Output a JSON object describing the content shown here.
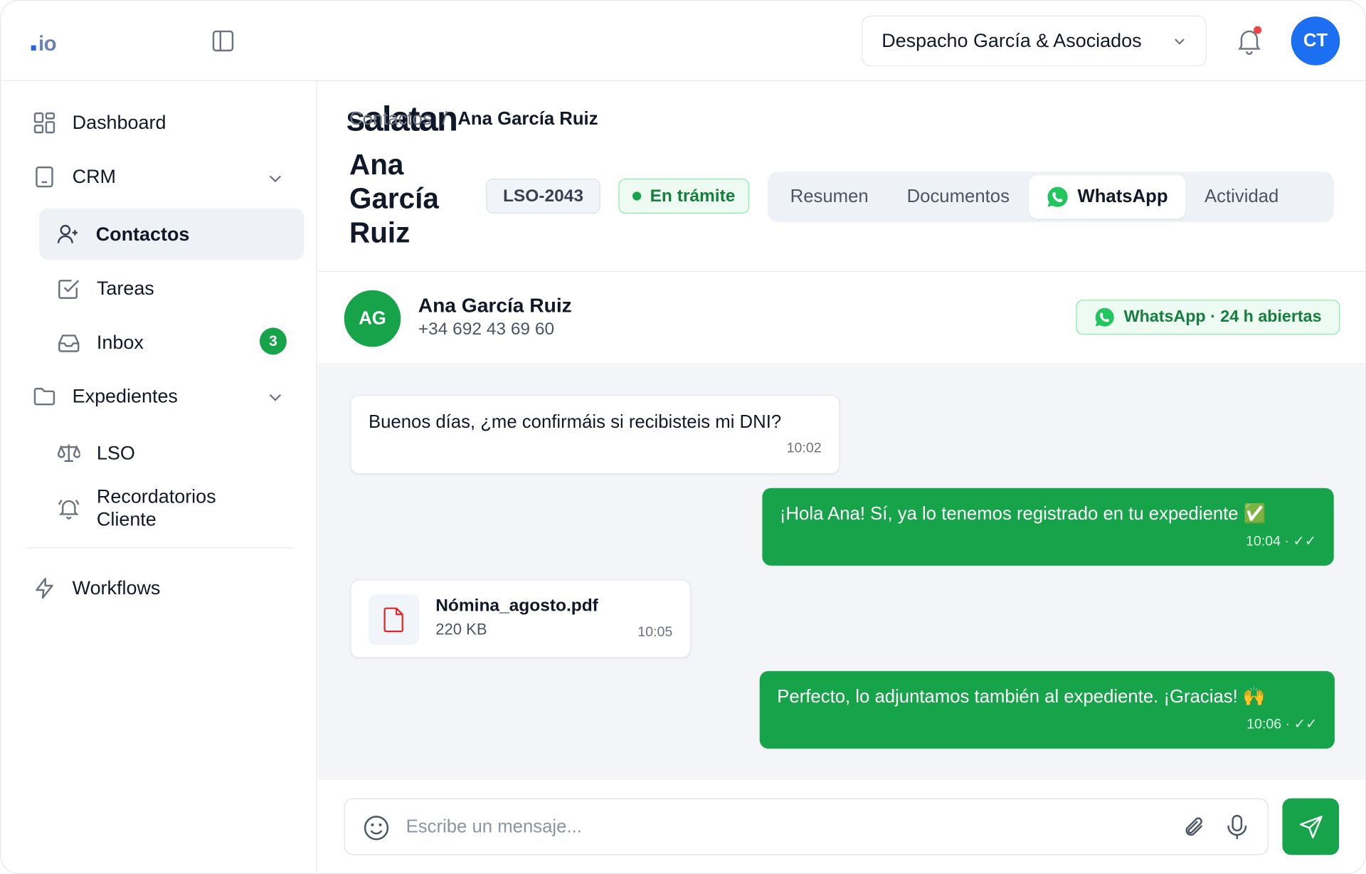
{
  "header": {
    "logo": {
      "main": "salatan",
      "dot": ".",
      "tld": "io"
    },
    "org_name": "Despacho García & Asociados",
    "user_initials": "CT",
    "notification_dot_color": "#ef4444"
  },
  "sidebar": {
    "items": [
      {
        "label": "Dashboard",
        "icon": "dashboard-grid-icon"
      },
      {
        "label": "CRM",
        "icon": "tablet-icon",
        "expanded": true
      },
      {
        "label": "Contactos",
        "icon": "user-plus-icon",
        "active": true
      },
      {
        "label": "Tareas",
        "icon": "checkbox-icon"
      },
      {
        "label": "Inbox",
        "icon": "inbox-tray-icon",
        "badge": "3"
      },
      {
        "label": "Expedientes",
        "icon": "folder-icon",
        "expanded": true
      },
      {
        "label": "LSO",
        "icon": "scale-icon"
      },
      {
        "label": "Recordatorios Cliente",
        "icon": "bell-ring-icon"
      },
      {
        "label": "Workflows",
        "icon": "lightning-icon"
      }
    ]
  },
  "breadcrumb": {
    "parent": "Contactos",
    "separator": "/",
    "current": "Ana García Ruiz"
  },
  "page": {
    "title": "Ana García Ruiz",
    "case_id": "LSO-2043",
    "status": "En trámite",
    "tabs": [
      {
        "label": "Resumen"
      },
      {
        "label": "Documentos"
      },
      {
        "label": "WhatsApp",
        "active": true
      },
      {
        "label": "Actividad"
      }
    ]
  },
  "chat": {
    "contact_initials": "AG",
    "contact_name": "Ana García Ruiz",
    "contact_phone": "+34 692 43 69 60",
    "window_badge": "WhatsApp · 24 h abiertas",
    "messages": [
      {
        "direction": "in",
        "text": "Buenos días, ¿me confirmáis si recibisteis mi DNI?",
        "time": "10:02"
      },
      {
        "direction": "out",
        "text": "¡Hola Ana! Sí, ya lo tenemos registrado en tu expediente ✅",
        "time": "10:04 · ✓✓"
      },
      {
        "direction": "in",
        "type": "file",
        "file_name": "Nómina_agosto.pdf",
        "file_size": "220 KB",
        "time": "10:05"
      },
      {
        "direction": "out",
        "text": "Perfecto, lo adjuntamos también al expediente. ¡Gracias! 🙌",
        "time": "10:06 · ✓✓"
      }
    ]
  },
  "composer": {
    "placeholder": "Escribe un mensaje..."
  },
  "colors": {
    "accent": "#16a34a",
    "brand_blue": "#2563eb",
    "avatar_blue": "#1d6ff2"
  }
}
